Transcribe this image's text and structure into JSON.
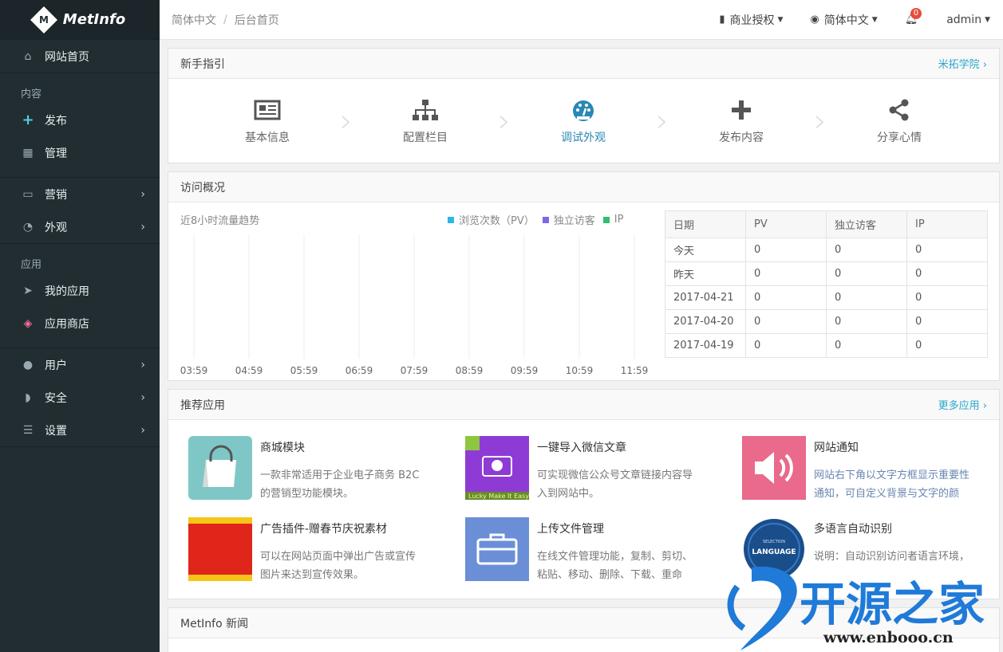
{
  "brand": {
    "logo_text": "MetInfo",
    "logo_letter": "M"
  },
  "sidebar": {
    "home": "网站首页",
    "group_content": "内容",
    "publish": "发布",
    "manage": "管理",
    "marketing": "营销",
    "appearance": "外观",
    "group_apps": "应用",
    "my_apps": "我的应用",
    "app_store": "应用商店",
    "users": "用户",
    "security": "安全",
    "settings": "设置"
  },
  "topbar": {
    "breadcrumb_1": "简体中文",
    "breadcrumb_2": "后台首页",
    "license": "商业授权",
    "language": "简体中文",
    "notify_count": "0",
    "user": "admin"
  },
  "guide": {
    "title": "新手指引",
    "link": "米拓学院",
    "steps": [
      "基本信息",
      "配置栏目",
      "调试外观",
      "发布内容",
      "分享心情"
    ],
    "active_index": 2
  },
  "visits": {
    "title": "访问概况",
    "chart_title": "近8小时流量趋势",
    "legend": [
      "浏览次数（PV）",
      "独立访客",
      "IP"
    ],
    "legend_colors": [
      "#2ab7e8",
      "#7b68ee",
      "#2fbf71"
    ],
    "x_labels": [
      "03:59",
      "04:59",
      "05:59",
      "06:59",
      "07:59",
      "08:59",
      "09:59",
      "10:59",
      "11:59"
    ],
    "table": {
      "headers": [
        "日期",
        "PV",
        "独立访客",
        "IP"
      ],
      "rows": [
        [
          "今天",
          "0",
          "0",
          "0"
        ],
        [
          "昨天",
          "0",
          "0",
          "0"
        ],
        [
          "2017-04-21",
          "0",
          "0",
          "0"
        ],
        [
          "2017-04-20",
          "0",
          "0",
          "0"
        ],
        [
          "2017-04-19",
          "0",
          "0",
          "0"
        ]
      ]
    }
  },
  "apps": {
    "title": "推荐应用",
    "more": "更多应用",
    "items": [
      {
        "name": "商城模块",
        "desc": "一款非常适用于企业电子商务 B2C 的营销型功能模块。"
      },
      {
        "name": "一键导入微信文章",
        "desc": "可实现微信公众号文章链接内容导入到网站中。"
      },
      {
        "name": "网站通知",
        "desc": "网站右下角以文字方框显示重要性通知，可自定义背景与文字的颜"
      },
      {
        "name": "广告插件-赠春节庆祝素材",
        "desc": "可以在网站页面中弹出广告或宣传图片来达到宣传效果。"
      },
      {
        "name": "上传文件管理",
        "desc": "在线文件管理功能，复制、剪切、粘贴、移动、删除、下载、重命"
      },
      {
        "name": "多语言自动识别",
        "desc": "说明：自动识别访问者语言环境，"
      }
    ],
    "thumb_text_wechat": "Lucky Make It Easy",
    "thumb_text_lang_top": "SELECTION",
    "thumb_text_lang": "LANGUAGE"
  },
  "news": {
    "title": "MetInfo 新闻"
  },
  "watermark": {
    "brand": "开源之家",
    "url": "www.enbooo.cn"
  }
}
